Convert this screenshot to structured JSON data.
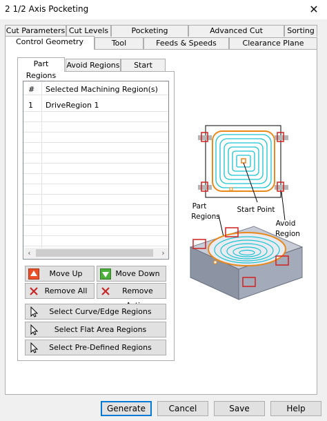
{
  "window": {
    "title": "2 1/2 Axis Pocketing",
    "close_glyph": "✕"
  },
  "tabs_row1": [
    {
      "label": "Cut Parameters"
    },
    {
      "label": "Cut Levels"
    },
    {
      "label": "Pocketing Entry/Exit"
    },
    {
      "label": "Advanced Cut Parameters"
    },
    {
      "label": "Sorting"
    }
  ],
  "tabs_row2": [
    {
      "label": "Control Geometry",
      "active": true
    },
    {
      "label": "Tool"
    },
    {
      "label": "Feeds & Speeds"
    },
    {
      "label": "Clearance Plane"
    }
  ],
  "subtabs": [
    {
      "label": "Part Regions",
      "active": true
    },
    {
      "label": "Avoid Regions"
    },
    {
      "label": "Start Points"
    }
  ],
  "regions_table": {
    "columns": [
      "#",
      "Selected Machining Region(s)"
    ],
    "rows": [
      {
        "num": "1",
        "name": "DriveRegion 1"
      }
    ]
  },
  "buttons": {
    "move_up": "Move Up",
    "move_down": "Move Down",
    "remove_all": "Remove All",
    "remove_active": "Remove Active",
    "select_curve": "Select Curve/Edge Regions",
    "select_flat": "Select Flat Area Regions",
    "select_predefined": "Select Pre-Defined Regions"
  },
  "illustration": {
    "start_point_label": "Start Point",
    "part_regions_label": [
      "Part",
      "Regions"
    ],
    "avoid_region_label": [
      "Avoid",
      "Region"
    ]
  },
  "colors": {
    "toolpath": "#19c4d4",
    "region_boundary": "#e8891a",
    "avoid_marker": "#d21f1f",
    "default_button_border": "#0078d7"
  },
  "footer": {
    "generate": "Generate",
    "cancel": "Cancel",
    "save": "Save",
    "help": "Help"
  }
}
